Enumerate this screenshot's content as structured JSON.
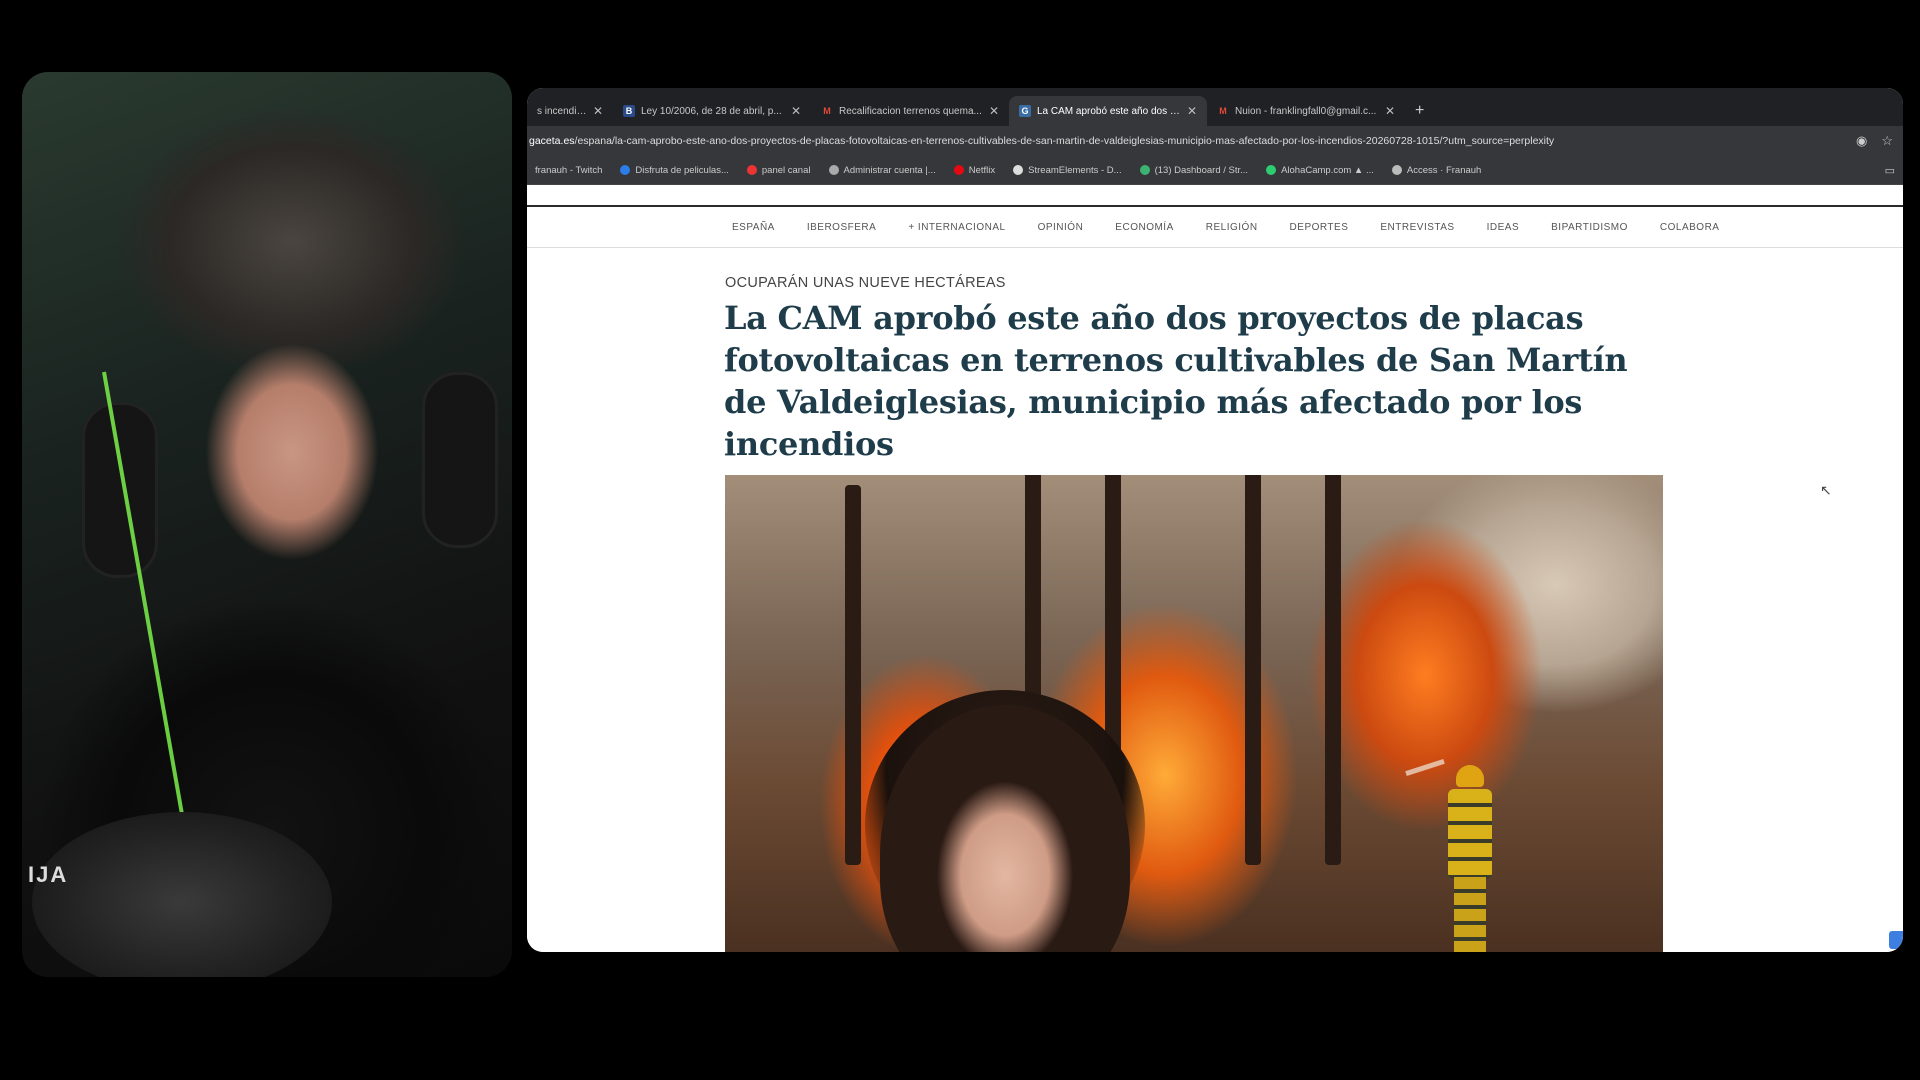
{
  "browser": {
    "tabs": [
      {
        "icon": "page-icon",
        "title": "s incendios h",
        "active": false
      },
      {
        "icon": "newspaper-icon",
        "title": "Ley 10/2006, de 28 de abril, p...",
        "active": false
      },
      {
        "icon": "gmail-icon",
        "title": "Recalificacion terrenos quema...",
        "active": false
      },
      {
        "icon": "site-icon",
        "title": "La CAM aprobó este año dos p...",
        "active": true
      },
      {
        "icon": "gmail-icon",
        "title": "Nuion - franklingfall0@gmail.c...",
        "active": false
      }
    ],
    "new_tab": "+",
    "url_domain": "gaceta.es",
    "url_path": "/espana/la-cam-aprobo-este-ano-dos-proyectos-de-placas-fotovoltaicas-en-terrenos-cultivables-de-san-martin-de-valdeiglesias-municipio-mas-afectado-por-los-incendios-20260728-1015/?utm_source=perplexity",
    "bookmarks": [
      {
        "label": "franauh - Twitch",
        "color": "#7a4bd6"
      },
      {
        "label": "Disfruta de peliculas...",
        "color": "#2b7de9"
      },
      {
        "label": "panel canal",
        "color": "#e33"
      },
      {
        "label": "Administrar cuenta |...",
        "color": "#aaa"
      },
      {
        "label": "Netflix",
        "color": "#e50914"
      },
      {
        "label": "StreamElements - D...",
        "color": "#ddd"
      },
      {
        "label": "(13) Dashboard / Str...",
        "color": "#3cb371"
      },
      {
        "label": "AlohaCamp.com ▲ ...",
        "color": "#2ecc71"
      },
      {
        "label": "Access · Franauh",
        "color": "#bbb"
      }
    ]
  },
  "site": {
    "nav": [
      "ESPAÑA",
      "IBEROSFERA",
      "+ INTERNACIONAL",
      "OPINIÓN",
      "ECONOMÍA",
      "RELIGIÓN",
      "DEPORTES",
      "ENTREVISTAS",
      "IDEAS",
      "BIPARTIDISMO",
      "COLABORA"
    ],
    "kicker": "OCUPARÁN UNAS NUEVE HECTÁREAS",
    "headline": "La CAM aprobó este año dos proyectos de placas fotovoltaicas en terrenos cultivables de San Martín de Valdeiglesias, municipio más afectado por los incendios"
  },
  "webcam": {
    "shirt_text": "IJA"
  },
  "colors": {
    "headline": "#1f3c4a",
    "browser_chrome": "#35373a",
    "tabbar": "#1f2124"
  }
}
